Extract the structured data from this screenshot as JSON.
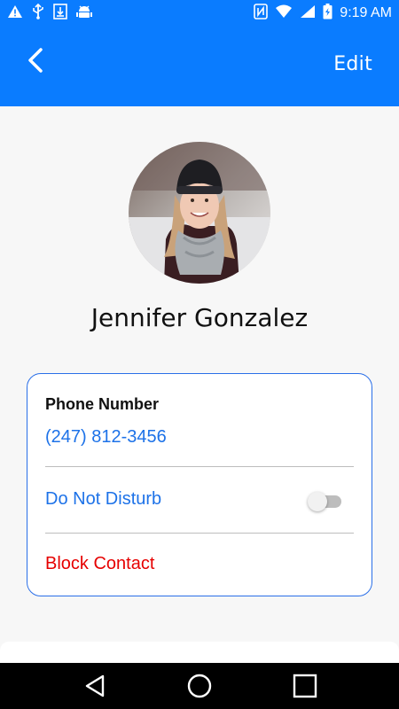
{
  "status_bar": {
    "time": "9:19 AM",
    "left_icons": [
      "warning-icon",
      "usb-icon",
      "download-icon",
      "android-debug-icon"
    ],
    "right_icons": [
      "nfc-icon",
      "wifi-icon",
      "signal-icon",
      "battery-icon"
    ]
  },
  "app_bar": {
    "back_icon": "chevron-left-icon",
    "edit_label": "Edit",
    "color": "#0a7cff"
  },
  "contact": {
    "name": "Jennifer Gonzalez"
  },
  "details": {
    "phone_label": "Phone Number",
    "phone_value": "(247) 812-3456",
    "dnd_label": "Do Not Disturb",
    "dnd_enabled": false,
    "block_label": "Block Contact",
    "link_color": "#1d72e8",
    "danger_color": "#e60000",
    "border_color": "#2a6fe8"
  },
  "nav_bar": {
    "icons": [
      "back-triangle-icon",
      "home-circle-icon",
      "recents-square-icon"
    ]
  }
}
